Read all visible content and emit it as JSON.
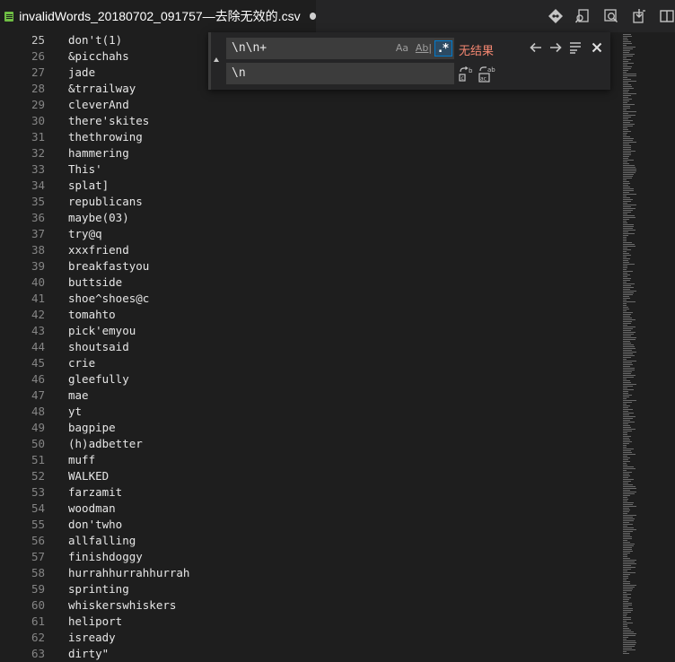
{
  "tab": {
    "title": "invalidWords_20180702_091757—去除无效的.csv",
    "file_icon": "spreadsheet-icon",
    "dirty": true
  },
  "toolbar": {
    "icons": [
      "git-compare-icon",
      "open-preview-icon",
      "search-preview-icon",
      "import-icon",
      "split-editor-icon"
    ]
  },
  "find": {
    "search_value": "\\n\\n+",
    "replace_value": "\\n",
    "option_case": "Aa",
    "option_word": "Ab|",
    "option_regex": ".*",
    "result_text": "无结果",
    "prev_icon": "arrow-left-icon",
    "next_icon": "arrow-right-icon",
    "selection_icon": "find-in-selection-icon",
    "close_icon": "close-icon",
    "replace_one_icon": "replace-icon",
    "replace_all_icon": "replace-all-icon"
  },
  "colors": {
    "background": "#1e1e1e",
    "no_result": "#f48771",
    "accent": "#007acc",
    "csv_icon": "#6fbf44"
  },
  "lines": [
    {
      "n": "25",
      "text": "don't(1)"
    },
    {
      "n": "26",
      "text": "&picchahs"
    },
    {
      "n": "27",
      "text": "jade"
    },
    {
      "n": "28",
      "text": "&trrailway"
    },
    {
      "n": "29",
      "text": "cleverAnd"
    },
    {
      "n": "30",
      "text": "there'skites"
    },
    {
      "n": "31",
      "text": "thethrowing"
    },
    {
      "n": "32",
      "text": "hammering"
    },
    {
      "n": "33",
      "text": "This'"
    },
    {
      "n": "34",
      "text": "splat]"
    },
    {
      "n": "35",
      "text": "republicans"
    },
    {
      "n": "36",
      "text": "maybe(03)"
    },
    {
      "n": "37",
      "text": "try@q"
    },
    {
      "n": "38",
      "text": "xxxfriend"
    },
    {
      "n": "39",
      "text": "breakfastyou"
    },
    {
      "n": "40",
      "text": "buttside"
    },
    {
      "n": "41",
      "text": "shoe^shoes@c"
    },
    {
      "n": "42",
      "text": "tomahto"
    },
    {
      "n": "43",
      "text": "pick'emyou"
    },
    {
      "n": "44",
      "text": "shoutsaid"
    },
    {
      "n": "45",
      "text": "crie"
    },
    {
      "n": "46",
      "text": "gleefully"
    },
    {
      "n": "47",
      "text": "mae"
    },
    {
      "n": "48",
      "text": "yt"
    },
    {
      "n": "49",
      "text": "bagpipe"
    },
    {
      "n": "50",
      "text": "(h)adbetter"
    },
    {
      "n": "51",
      "text": "muff"
    },
    {
      "n": "52",
      "text": "WALKED"
    },
    {
      "n": "53",
      "text": "farzamit"
    },
    {
      "n": "54",
      "text": "woodman"
    },
    {
      "n": "55",
      "text": "don'twho"
    },
    {
      "n": "56",
      "text": "allfalling"
    },
    {
      "n": "57",
      "text": "finishdoggy"
    },
    {
      "n": "58",
      "text": "hurrahhurrahhurrah"
    },
    {
      "n": "59",
      "text": "sprinting"
    },
    {
      "n": "60",
      "text": "whiskerswhiskers"
    },
    {
      "n": "61",
      "text": "heliport"
    },
    {
      "n": "62",
      "text": "isready"
    },
    {
      "n": "63",
      "text": "dirty\""
    }
  ]
}
